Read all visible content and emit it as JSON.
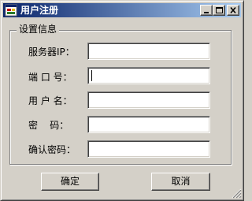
{
  "window": {
    "title": "用户注册",
    "icon": "app-form-icon",
    "controls": [
      "minimize-icon",
      "maximize-icon",
      "close-icon"
    ]
  },
  "group": {
    "title": "设置信息"
  },
  "fields": {
    "server_ip": {
      "label": "服务器IP：",
      "value": ""
    },
    "port": {
      "label": "端 口 号：",
      "value": ""
    },
    "username": {
      "label": "用 户 名：",
      "value": ""
    },
    "password": {
      "label": "密    码：",
      "value": ""
    },
    "confirm_password": {
      "label": "确认密码：",
      "value": ""
    }
  },
  "buttons": {
    "ok": "确定",
    "cancel": "取消"
  },
  "colors": {
    "face": "#d4d0c8",
    "title_start": "#0a246a",
    "title_end": "#a6caf0"
  }
}
